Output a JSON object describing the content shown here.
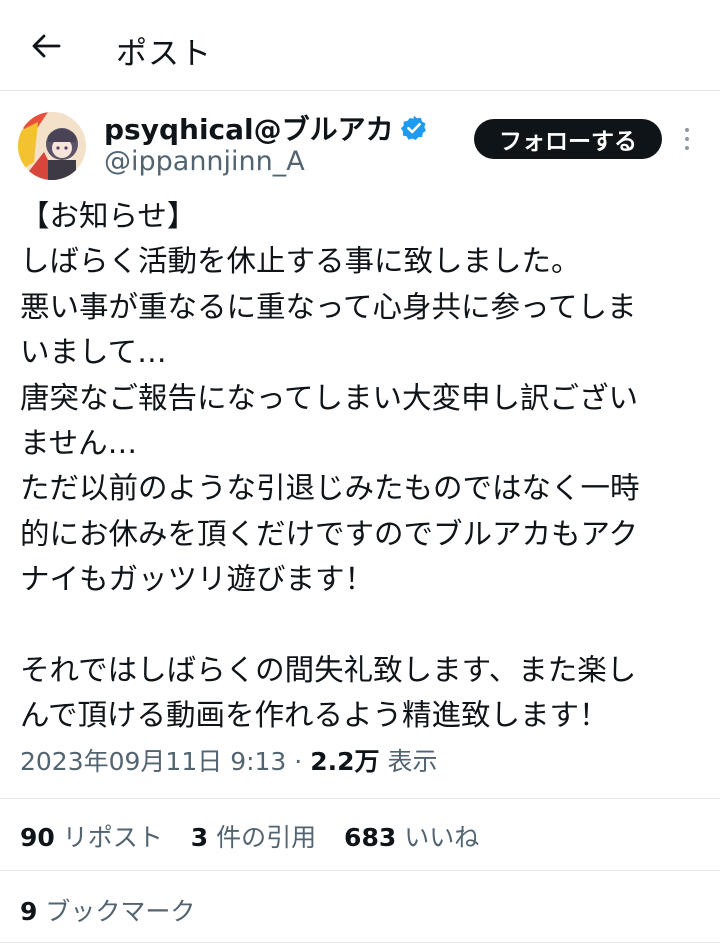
{
  "header": {
    "title": "ポスト"
  },
  "author": {
    "display_name": "psyqhical@ブルアカ",
    "handle": "@ippannjinn_A"
  },
  "follow_label": "フォローする",
  "post": {
    "lines": [
      "【お知らせ】",
      "しばらく活動を休止する事に致しました。",
      "悪い事が重なるに重なって心身共に参ってしま",
      "いまして…",
      "唐突なご報告になってしまい大変申し訳ござい",
      "ません…",
      "ただ以前のような引退じみたものではなく一時",
      "的にお休みを頂くだけですのでブルアカもアク",
      "ナイもガッツリ遊びます！",
      "",
      "それではしばらくの間失礼致します、また楽し",
      "んで頂ける動画を作れるよう精進致します！"
    ]
  },
  "meta": {
    "timestamp": "2023年09月11日 9:13",
    "separator": "·",
    "views_count": "2.2万",
    "views_label": "表示"
  },
  "stats": {
    "reposts_count": "90",
    "reposts_label": "リポスト",
    "quotes_count": "3",
    "quotes_label": "件の引用",
    "likes_count": "683",
    "likes_label": "いいね",
    "bookmarks_count": "9",
    "bookmarks_label": "ブックマーク"
  },
  "colors": {
    "text_primary": "#0f1419",
    "text_secondary": "#536471",
    "verified": "#1d9bf0",
    "divider": "#e4e7ea",
    "follow_bg": "#0f1419"
  },
  "icons": {
    "back": "arrow-left-icon",
    "verified": "verified-badge-icon",
    "more": "more-vertical-icon"
  }
}
